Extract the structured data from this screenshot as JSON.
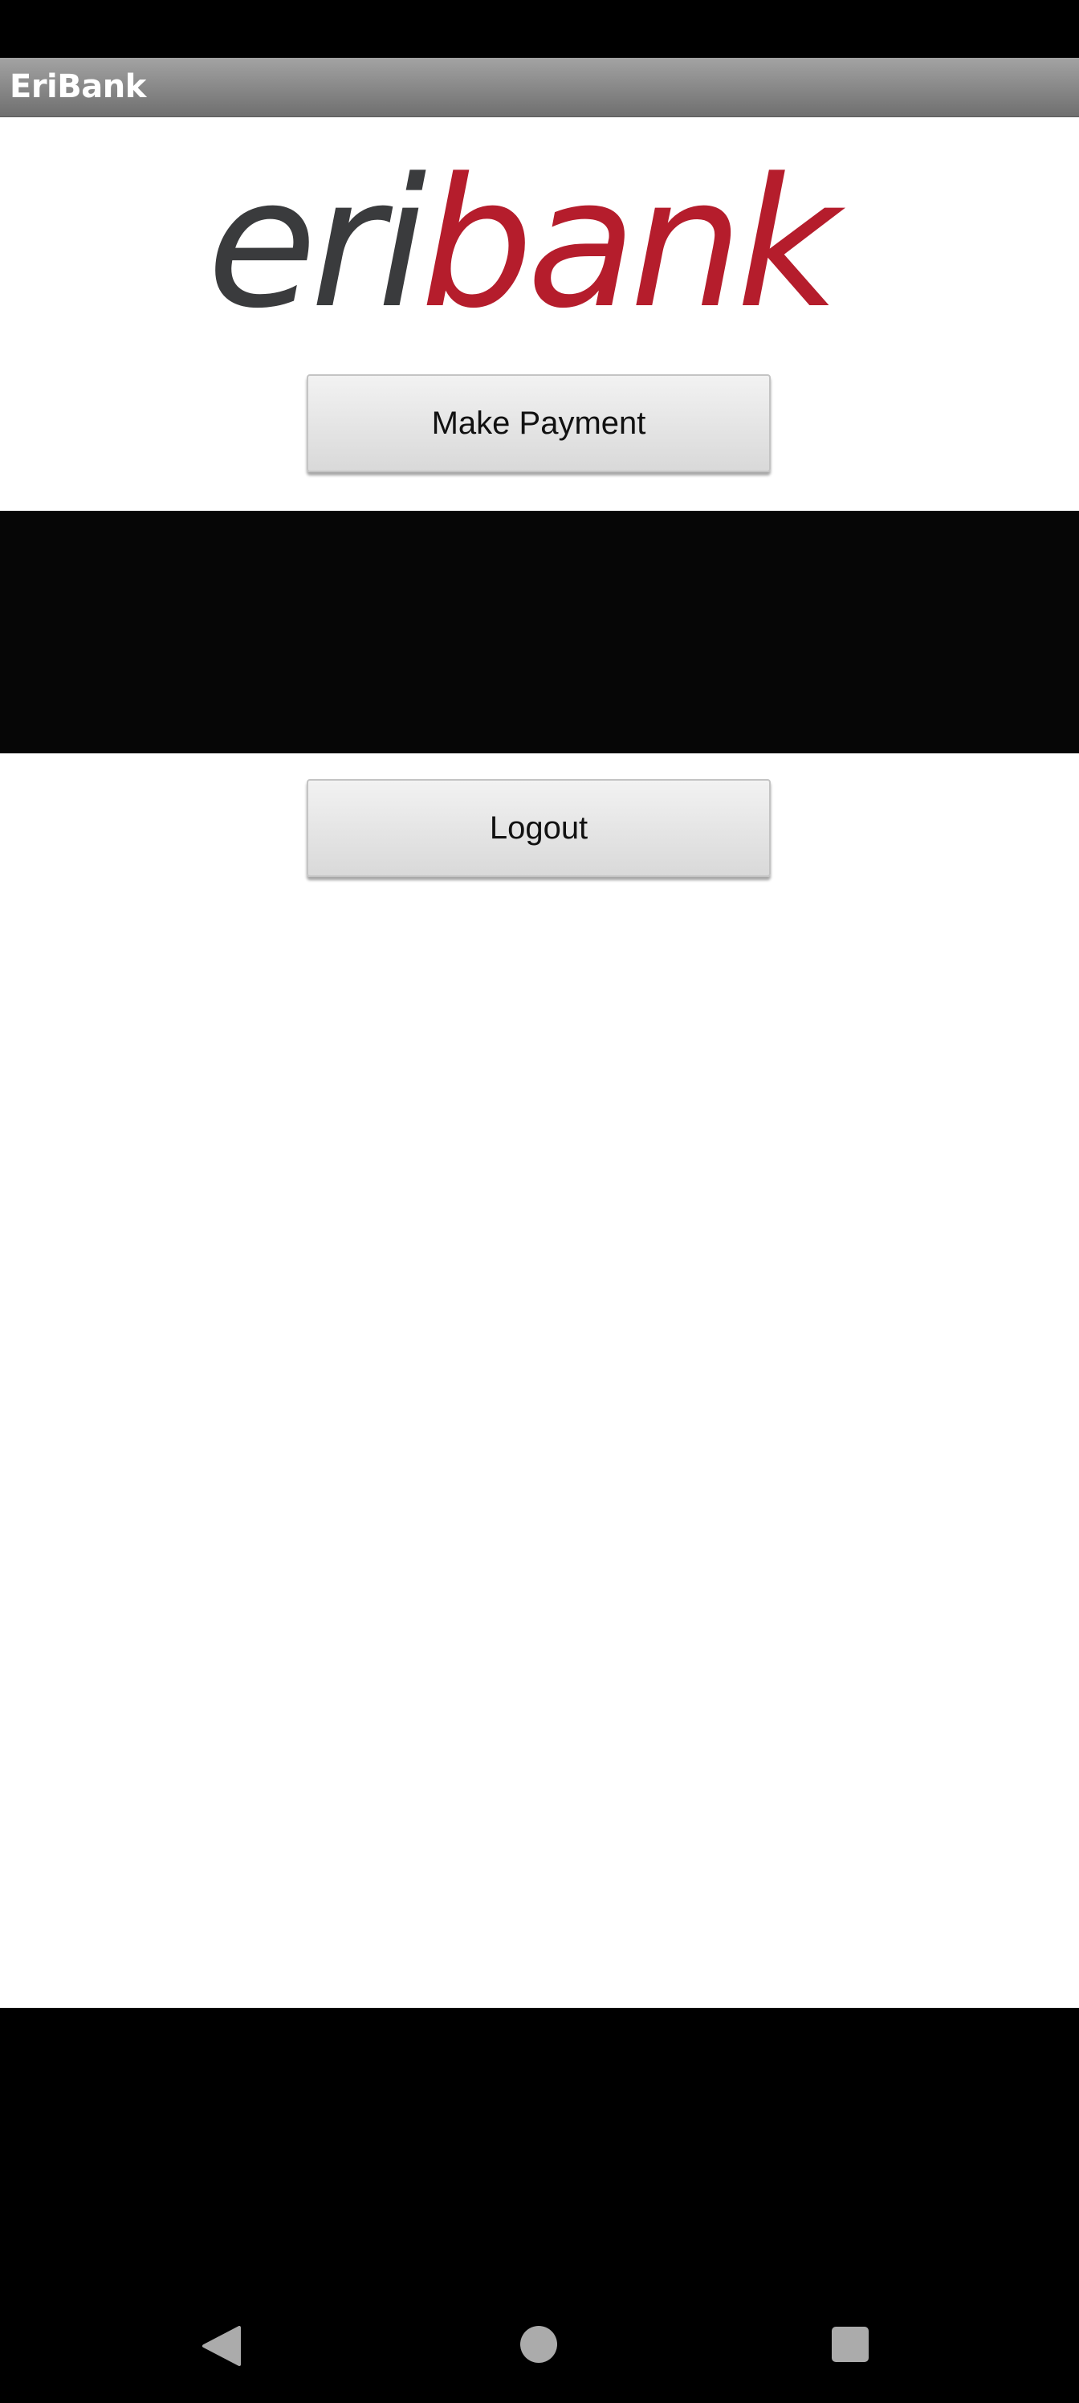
{
  "app": {
    "title": "EriBank"
  },
  "logo": {
    "text_part1": "eri",
    "text_part2": "bank",
    "colors": {
      "part1": "#3a3b3d",
      "part2": "#b51d2c"
    }
  },
  "buttons": {
    "make_payment_label": "Make Payment",
    "logout_label": "Logout"
  },
  "navigation": {
    "back_icon": "back-triangle-icon",
    "home_icon": "home-circle-icon",
    "recent_icon": "recent-apps-square-icon"
  }
}
